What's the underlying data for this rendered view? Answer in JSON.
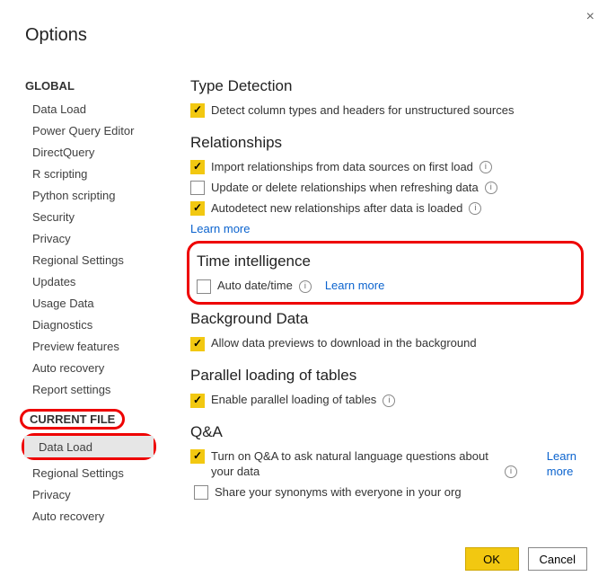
{
  "window": {
    "title": "Options",
    "close_label": "×"
  },
  "buttons": {
    "ok": "OK",
    "cancel": "Cancel"
  },
  "sidebar": {
    "global_header": "GLOBAL",
    "current_file_header": "CURRENT FILE",
    "global": [
      "Data Load",
      "Power Query Editor",
      "DirectQuery",
      "R scripting",
      "Python scripting",
      "Security",
      "Privacy",
      "Regional Settings",
      "Updates",
      "Usage Data",
      "Diagnostics",
      "Preview features",
      "Auto recovery",
      "Report settings"
    ],
    "current_file": [
      "Data Load",
      "Regional Settings",
      "Privacy",
      "Auto recovery"
    ]
  },
  "sections": {
    "type_detection": {
      "title": "Type Detection",
      "opt1": {
        "label": "Detect column types and headers for unstructured sources",
        "checked": true
      }
    },
    "relationships": {
      "title": "Relationships",
      "opt1": {
        "label": "Import relationships from data sources on first load",
        "checked": true,
        "info": true
      },
      "opt2": {
        "label": "Update or delete relationships when refreshing data",
        "checked": false,
        "info": true
      },
      "opt3": {
        "label": "Autodetect new relationships after data is loaded",
        "checked": true,
        "info": true
      },
      "learn_more": "Learn more"
    },
    "time_intelligence": {
      "title": "Time intelligence",
      "opt1": {
        "label": "Auto date/time",
        "checked": false,
        "info": true
      },
      "learn_more": "Learn more"
    },
    "background_data": {
      "title": "Background Data",
      "opt1": {
        "label": "Allow data previews to download in the background",
        "checked": true
      }
    },
    "parallel": {
      "title": "Parallel loading of tables",
      "opt1": {
        "label": "Enable parallel loading of tables",
        "checked": true,
        "info": true
      }
    },
    "qna": {
      "title": "Q&A",
      "opt1": {
        "label": "Turn on Q&A to ask natural language questions about your data",
        "checked": true,
        "info": true
      },
      "opt2": {
        "label": "Share your synonyms with everyone in your org",
        "checked": false
      },
      "learn_more": "Learn\nmore"
    }
  }
}
